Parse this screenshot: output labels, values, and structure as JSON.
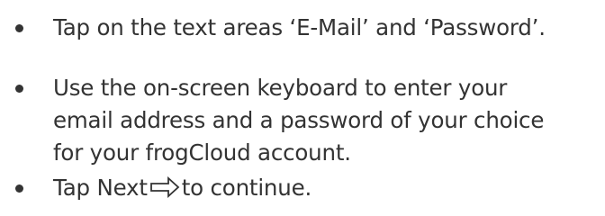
{
  "instructions": {
    "step1": {
      "line1": "Tap on the text areas ‘E-Mail’ and ‘Password’."
    },
    "step2": {
      "line1": "Use the on-screen keyboard to enter your",
      "line2": "email address and a password of your choice",
      "line3": "for your frogCloud account."
    },
    "step3": {
      "before_icon": "Tap Next",
      "icon": "next-arrow-icon",
      "after_icon": "to continue."
    }
  },
  "colors": {
    "text": "#333333"
  }
}
